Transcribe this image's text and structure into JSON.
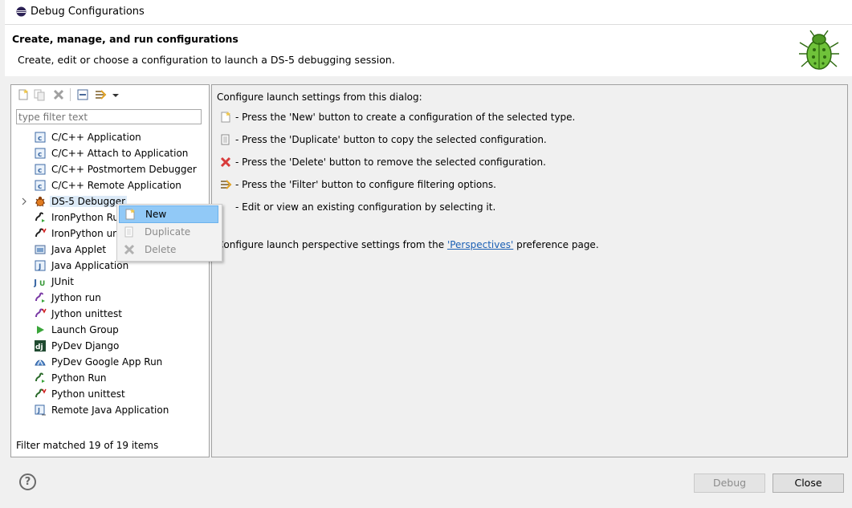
{
  "window": {
    "title": "Debug Configurations"
  },
  "banner": {
    "heading": "Create, manage, and run configurations",
    "subheading": "Create, edit or choose a configuration to launch a DS-5 debugging session."
  },
  "left": {
    "toolbar": [
      {
        "name": "new-configuration-icon"
      },
      {
        "name": "duplicate-configuration-icon"
      },
      {
        "name": "delete-configuration-icon"
      },
      {
        "name": "collapse-all-icon"
      },
      {
        "name": "filter-icon"
      },
      {
        "name": "view-menu-dropdown-icon"
      }
    ],
    "filter_placeholder": "type filter text",
    "items": [
      {
        "label": "C/C++ Application",
        "icon": "c-app-icon"
      },
      {
        "label": "C/C++ Attach to Application",
        "icon": "c-attach-icon"
      },
      {
        "label": "C/C++ Postmortem Debugger",
        "icon": "c-postmortem-icon"
      },
      {
        "label": "C/C++ Remote Application",
        "icon": "c-remote-icon"
      },
      {
        "label": "DS-5 Debugger",
        "icon": "ds5-debugger-icon",
        "selected": true,
        "expandable": true
      },
      {
        "label": "IronPython Ru",
        "icon": "ironpython-run-icon"
      },
      {
        "label": "IronPython un",
        "icon": "ironpython-unittest-icon"
      },
      {
        "label": "Java Applet",
        "icon": "java-applet-icon"
      },
      {
        "label": "Java Application",
        "icon": "java-application-icon"
      },
      {
        "label": "JUnit",
        "icon": "junit-icon"
      },
      {
        "label": "Jython run",
        "icon": "jython-run-icon"
      },
      {
        "label": "Jython unittest",
        "icon": "jython-unittest-icon"
      },
      {
        "label": "Launch Group",
        "icon": "launch-group-icon"
      },
      {
        "label": "PyDev Django",
        "icon": "pydev-django-icon"
      },
      {
        "label": "PyDev Google App Run",
        "icon": "pydev-google-app-icon"
      },
      {
        "label": "Python Run",
        "icon": "python-run-icon"
      },
      {
        "label": "Python unittest",
        "icon": "python-unittest-icon"
      },
      {
        "label": "Remote Java Application",
        "icon": "remote-java-icon"
      }
    ],
    "status": "Filter matched 19 of 19 items"
  },
  "right": {
    "intro": "Configure launch settings from this dialog:",
    "lines": [
      {
        "text": "- Press the 'New' button to create a configuration of the selected type.",
        "icon": "new-icon"
      },
      {
        "text": "- Press the 'Duplicate' button to copy the selected configuration.",
        "icon": "duplicate-icon"
      },
      {
        "text": "- Press the 'Delete' button to remove the selected configuration.",
        "icon": "delete-icon"
      },
      {
        "text": "- Press the 'Filter' button to configure filtering options.",
        "icon": "filter-icon"
      },
      {
        "text": "- Edit or view an existing configuration by selecting it.",
        "icon": ""
      }
    ],
    "perspectives_prefix": "Configure launch perspective settings from the ",
    "perspectives_link": "'Perspectives'",
    "perspectives_suffix": " preference page."
  },
  "context_menu": {
    "items": [
      {
        "label": "New",
        "enabled": true,
        "highlighted": true
      },
      {
        "label": "Duplicate",
        "enabled": false
      },
      {
        "label": "Delete",
        "enabled": false
      }
    ]
  },
  "buttons": {
    "debug": "Debug",
    "close": "Close"
  },
  "colors": {
    "selection": "#dceaf7",
    "menu_highlight": "#91c9f7",
    "link": "#1a5fb4"
  }
}
